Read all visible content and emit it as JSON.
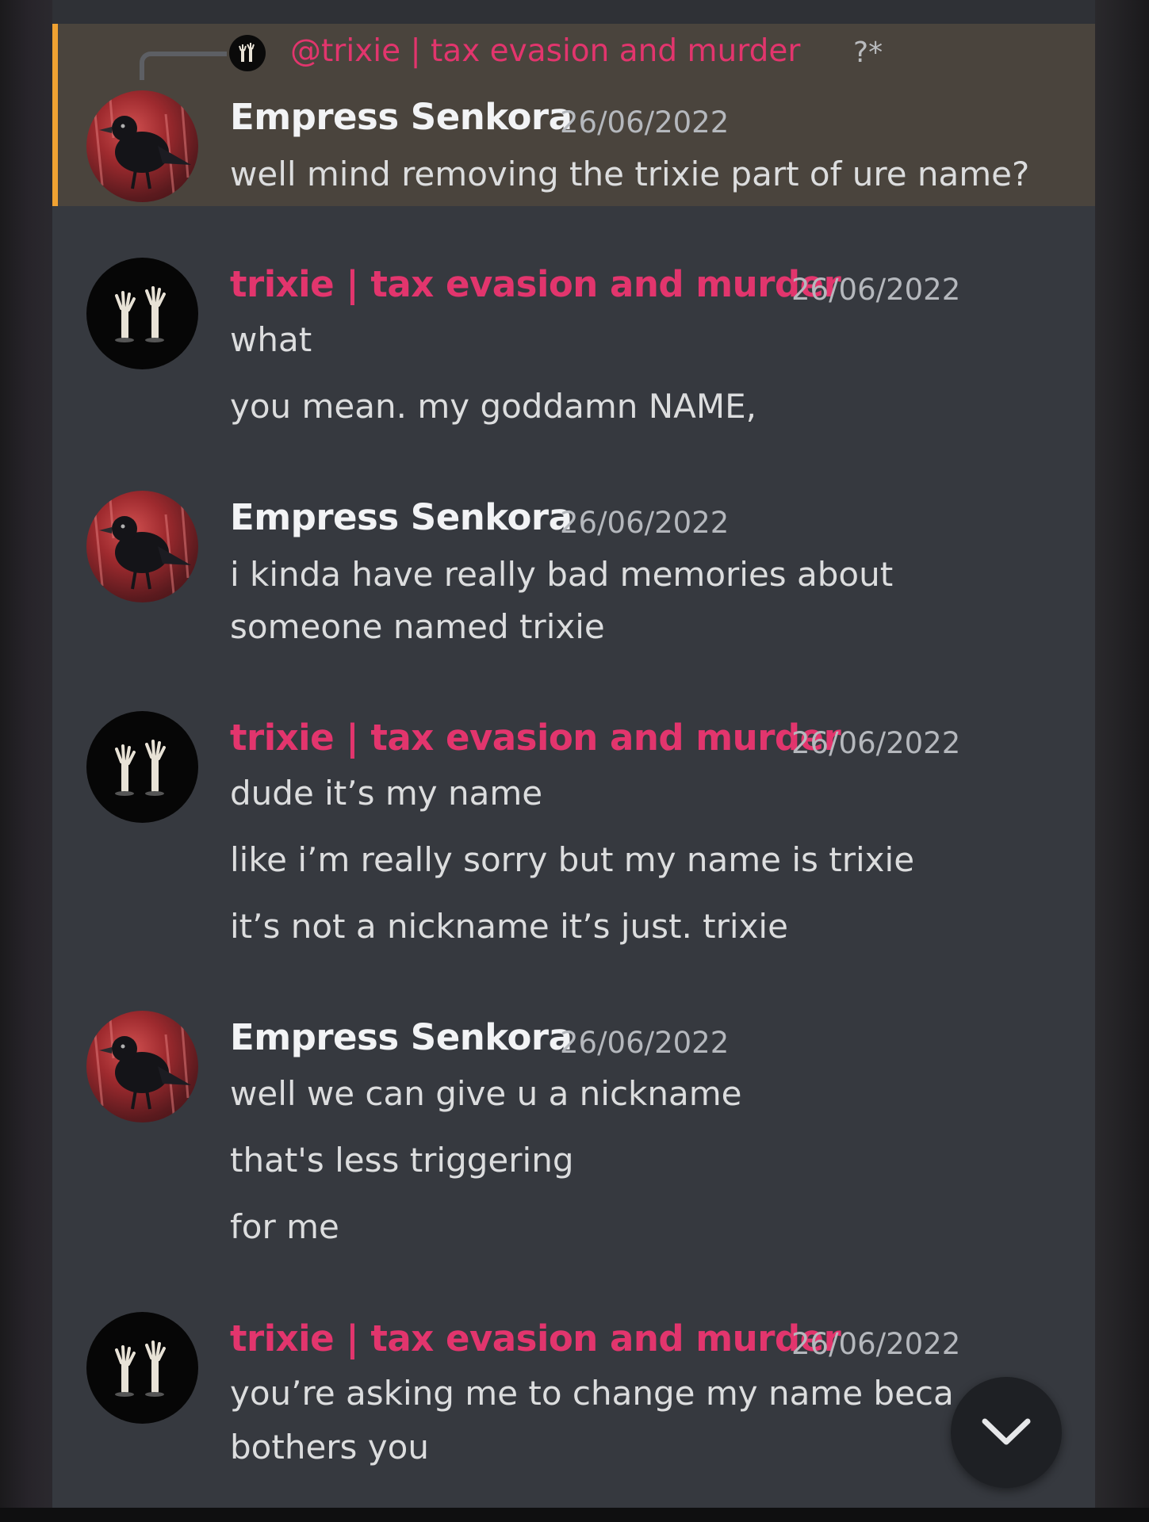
{
  "reply": {
    "mention": "@trixie | tax evasion and murder",
    "suffix": "?*"
  },
  "users": {
    "empress": "Empress Senkora",
    "trixie": "trixie | tax evasion and murder"
  },
  "messages": [
    {
      "author": "Empress Senkora",
      "timestamp": "26/06/2022",
      "lines": [
        "well mind removing the trixie part of ure name?"
      ]
    },
    {
      "author": "trixie | tax evasion and murder",
      "timestamp": "26/06/2022",
      "lines": [
        "what",
        "you mean. my goddamn NAME,"
      ]
    },
    {
      "author": "Empress Senkora",
      "timestamp": "26/06/2022",
      "lines": [
        "i kinda have really bad memories about",
        "someone named trixie"
      ]
    },
    {
      "author": "trixie | tax evasion and murder",
      "timestamp": "26/06/2022",
      "lines": [
        "dude it’s my name",
        "like i’m really sorry but my name is trixie",
        "it’s not a nickname it’s just. trixie"
      ]
    },
    {
      "author": "Empress Senkora",
      "timestamp": "26/06/2022",
      "lines": [
        "well we can give u a nickname",
        "that's less triggering",
        "for me"
      ]
    },
    {
      "author": "trixie | tax evasion and murder",
      "timestamp": "26/06/2022",
      "lines": [
        "you’re asking me to change my name beca",
        "bothers you"
      ]
    }
  ],
  "colors": {
    "highlight_bar": "#f0a232",
    "trixie_role": "#e2356d"
  },
  "icons": {
    "scroll": "chevron-down-icon"
  }
}
